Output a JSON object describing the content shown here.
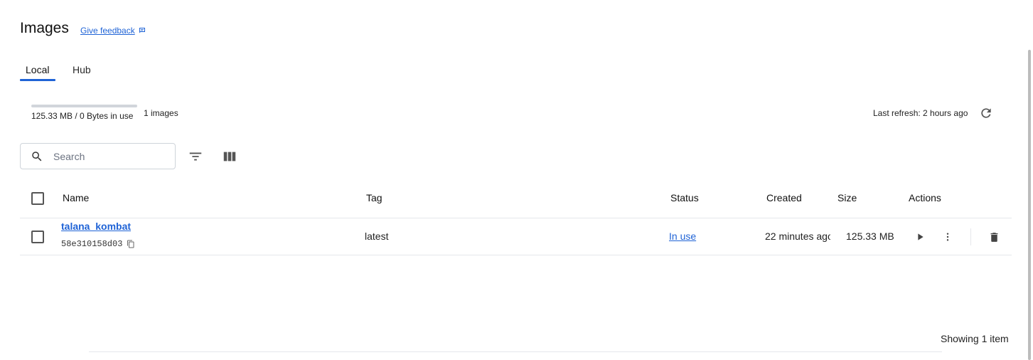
{
  "header": {
    "title": "Images",
    "feedback_label": "Give feedback",
    "feedback_icon": "chat-bubble-icon"
  },
  "tabs": [
    {
      "label": "Local",
      "active": true
    },
    {
      "label": "Hub",
      "active": false
    }
  ],
  "usage": {
    "text": "125.33 MB / 0 Bytes in use",
    "count_text": "1 images",
    "fill_fraction": 0
  },
  "refresh": {
    "text": "Last refresh: 2 hours ago",
    "icon": "refresh-icon"
  },
  "toolbar": {
    "search_placeholder": "Search",
    "search_value": "",
    "filter_icon": "filter-icon",
    "columns_icon": "columns-icon"
  },
  "table": {
    "columns": [
      "Name",
      "Tag",
      "Status",
      "Created",
      "Size",
      "Actions"
    ],
    "rows": [
      {
        "name": "talana_kombat",
        "id": "58e310158d03",
        "tag": "latest",
        "status": "In use",
        "created": "22 minutes ago",
        "size": "125.33 MB"
      }
    ]
  },
  "footer": {
    "showing": "Showing 1 item"
  },
  "colors": {
    "accent": "#1f63d6",
    "divider": "#e5e7eb"
  }
}
